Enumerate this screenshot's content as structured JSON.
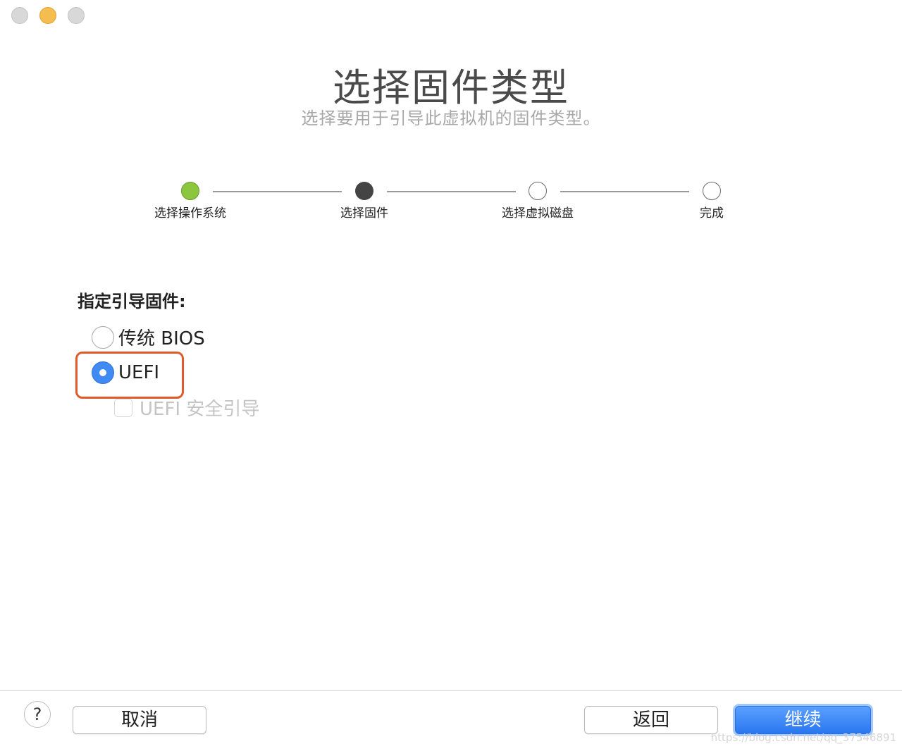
{
  "window": {
    "controls": [
      "close",
      "minimize",
      "zoom"
    ]
  },
  "header": {
    "title": "选择固件类型",
    "subtitle": "选择要用于引导此虚拟机的固件类型。"
  },
  "steps": [
    {
      "label": "选择操作系统",
      "state": "done"
    },
    {
      "label": "选择固件",
      "state": "current"
    },
    {
      "label": "选择虚拟磁盘",
      "state": "todo"
    },
    {
      "label": "完成",
      "state": "todo"
    }
  ],
  "firmware": {
    "section_label": "指定引导固件:",
    "options": [
      {
        "label": "传统 BIOS",
        "selected": false
      },
      {
        "label": "UEFI",
        "selected": true
      }
    ],
    "secure_boot": {
      "label": "UEFI 安全引导",
      "checked": false,
      "enabled": false
    }
  },
  "footer": {
    "help_label": "?",
    "cancel_label": "取消",
    "back_label": "返回",
    "continue_label": "继续"
  },
  "watermark": "https://blog.csdn.net/qq_37546891",
  "colors": {
    "accent": "#3f8af3",
    "step_done": "#8cc63f",
    "highlight": "#e05a2a"
  }
}
